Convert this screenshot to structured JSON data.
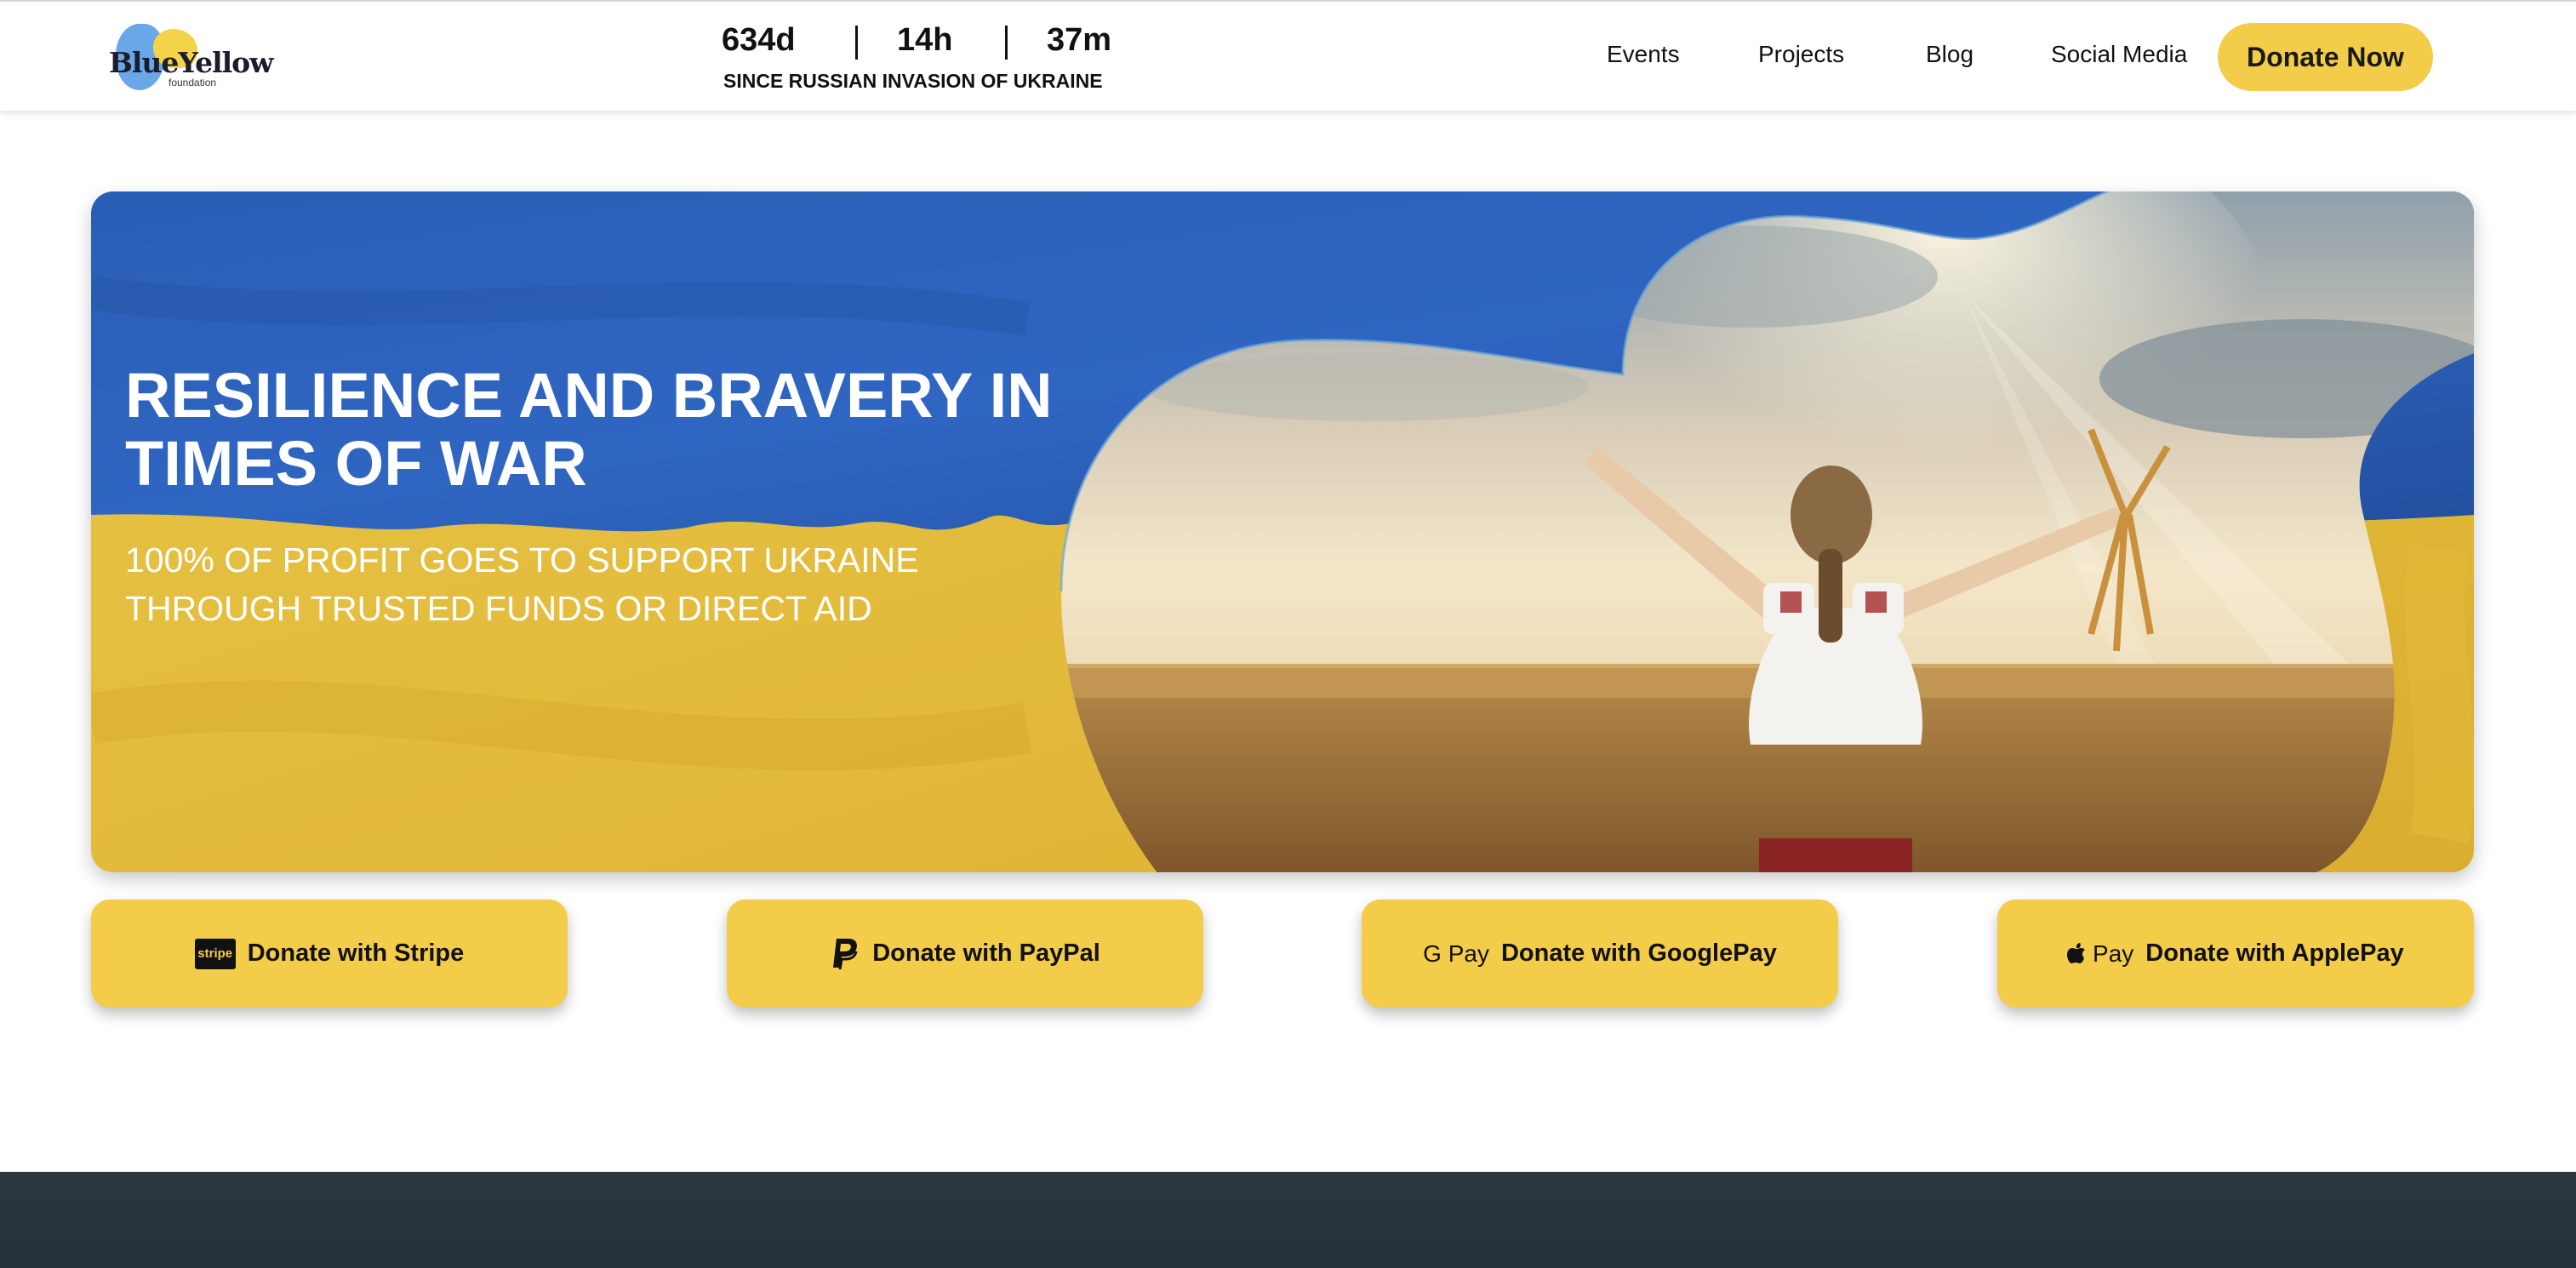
{
  "header": {
    "logo": {
      "text": "BlueYellow",
      "sub": "foundation"
    },
    "counter": {
      "days": "634d",
      "hours": "14h",
      "minutes": "37m",
      "since": "SINCE RUSSIAN INVASION OF UKRAINE"
    },
    "nav": [
      "Events",
      "Projects",
      "Blog",
      "Social Media"
    ],
    "donate_now": "Donate Now"
  },
  "hero": {
    "title": "RESILIENCE AND BRAVERY IN TIMES OF WAR",
    "subtitle": "100% OF PROFIT GOES TO SUPPORT UKRAINE THROUGH TRUSTED FUNDS OR DIRECT AID"
  },
  "donate_buttons": [
    {
      "label": "Donate with Stripe",
      "icon": "stripe-icon",
      "icon_text": "stripe"
    },
    {
      "label": "Donate with PayPal",
      "icon": "paypal-icon"
    },
    {
      "label": "Donate with GooglePay",
      "icon": "google-pay-icon",
      "icon_text": "G Pay"
    },
    {
      "label": "Donate with ApplePay",
      "icon": "apple-pay-icon",
      "icon_text": " Pay"
    }
  ],
  "colors": {
    "flag_blue": "#2a5fb8",
    "flag_yellow": "#e9c245",
    "accent_yellow": "#f3cc4a",
    "footer": "#2c363f"
  }
}
